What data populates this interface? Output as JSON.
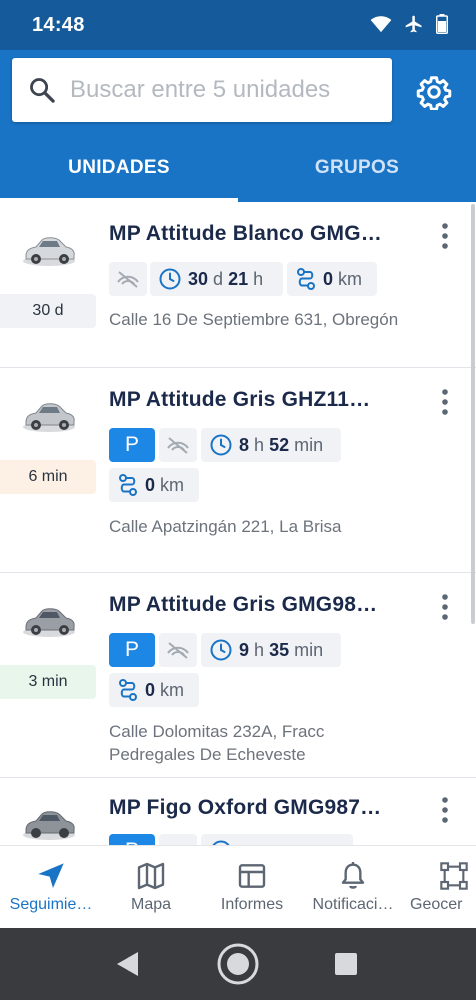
{
  "status_bar": {
    "time": "14:48",
    "icons": [
      "wifi-icon",
      "airplane-icon",
      "battery-icon"
    ]
  },
  "search": {
    "placeholder": "Buscar entre 5 unidades",
    "value": ""
  },
  "tabs": [
    {
      "label": "UNIDADES",
      "active": true
    },
    {
      "label": "GRUPOS",
      "active": false
    }
  ],
  "units": [
    {
      "name": "MP Attitude Blanco GMG…",
      "car_color": "silver",
      "time_badge": "30 d",
      "badge_color": "#f0f2f5",
      "parked": false,
      "duration": {
        "a_num": "30",
        "a_unit": "d",
        "b_num": "21",
        "b_unit": "h"
      },
      "distance": {
        "num": "0",
        "unit": "km"
      },
      "address": "Calle 16 De Septiembre 631, Obregón"
    },
    {
      "name": "MP Attitude Gris GHZ11…",
      "car_color": "light-gray",
      "time_badge": "6 min",
      "badge_color": "#fdf1e6",
      "parked": true,
      "parked_label": "P",
      "duration": {
        "a_num": "8",
        "a_unit": "h",
        "b_num": "52",
        "b_unit": "min"
      },
      "distance": {
        "num": "0",
        "unit": "km"
      },
      "address": "Calle Apatzingán 221, La Brisa"
    },
    {
      "name": "MP Attitude Gris GMG98…",
      "car_color": "gray",
      "time_badge": "3 min",
      "badge_color": "#e9f6ec",
      "parked": true,
      "parked_label": "P",
      "duration": {
        "a_num": "9",
        "a_unit": "h",
        "b_num": "35",
        "b_unit": "min"
      },
      "distance": {
        "num": "0",
        "unit": "km"
      },
      "address": "Calle Dolomitas 232A, Fracc Pedregales De Echeveste"
    },
    {
      "name": "MP Figo Oxford GMG987…",
      "car_color": "gray",
      "time_badge": "",
      "badge_color": "#f0f2f5",
      "parked": true,
      "parked_label": "P",
      "duration": {
        "a_num": "",
        "a_unit": "",
        "b_num": "",
        "b_unit": ""
      },
      "distance": {
        "num": "",
        "unit": ""
      },
      "address": ""
    }
  ],
  "bottom_nav": [
    {
      "label": "Seguimie…",
      "icon": "navigation-arrow-icon",
      "active": true
    },
    {
      "label": "Mapa",
      "icon": "map-icon",
      "active": false
    },
    {
      "label": "Informes",
      "icon": "table-icon",
      "active": false
    },
    {
      "label": "Notificaci…",
      "icon": "bell-icon",
      "active": false
    },
    {
      "label": "Geocer",
      "icon": "geofence-icon",
      "active": false
    }
  ],
  "system_nav": [
    "back-icon",
    "home-icon",
    "recents-icon"
  ],
  "colors": {
    "primary": "#1a74c6",
    "status_bar": "#155a9a",
    "parking": "#1d87e5",
    "text_dark": "#1b2a4a"
  }
}
